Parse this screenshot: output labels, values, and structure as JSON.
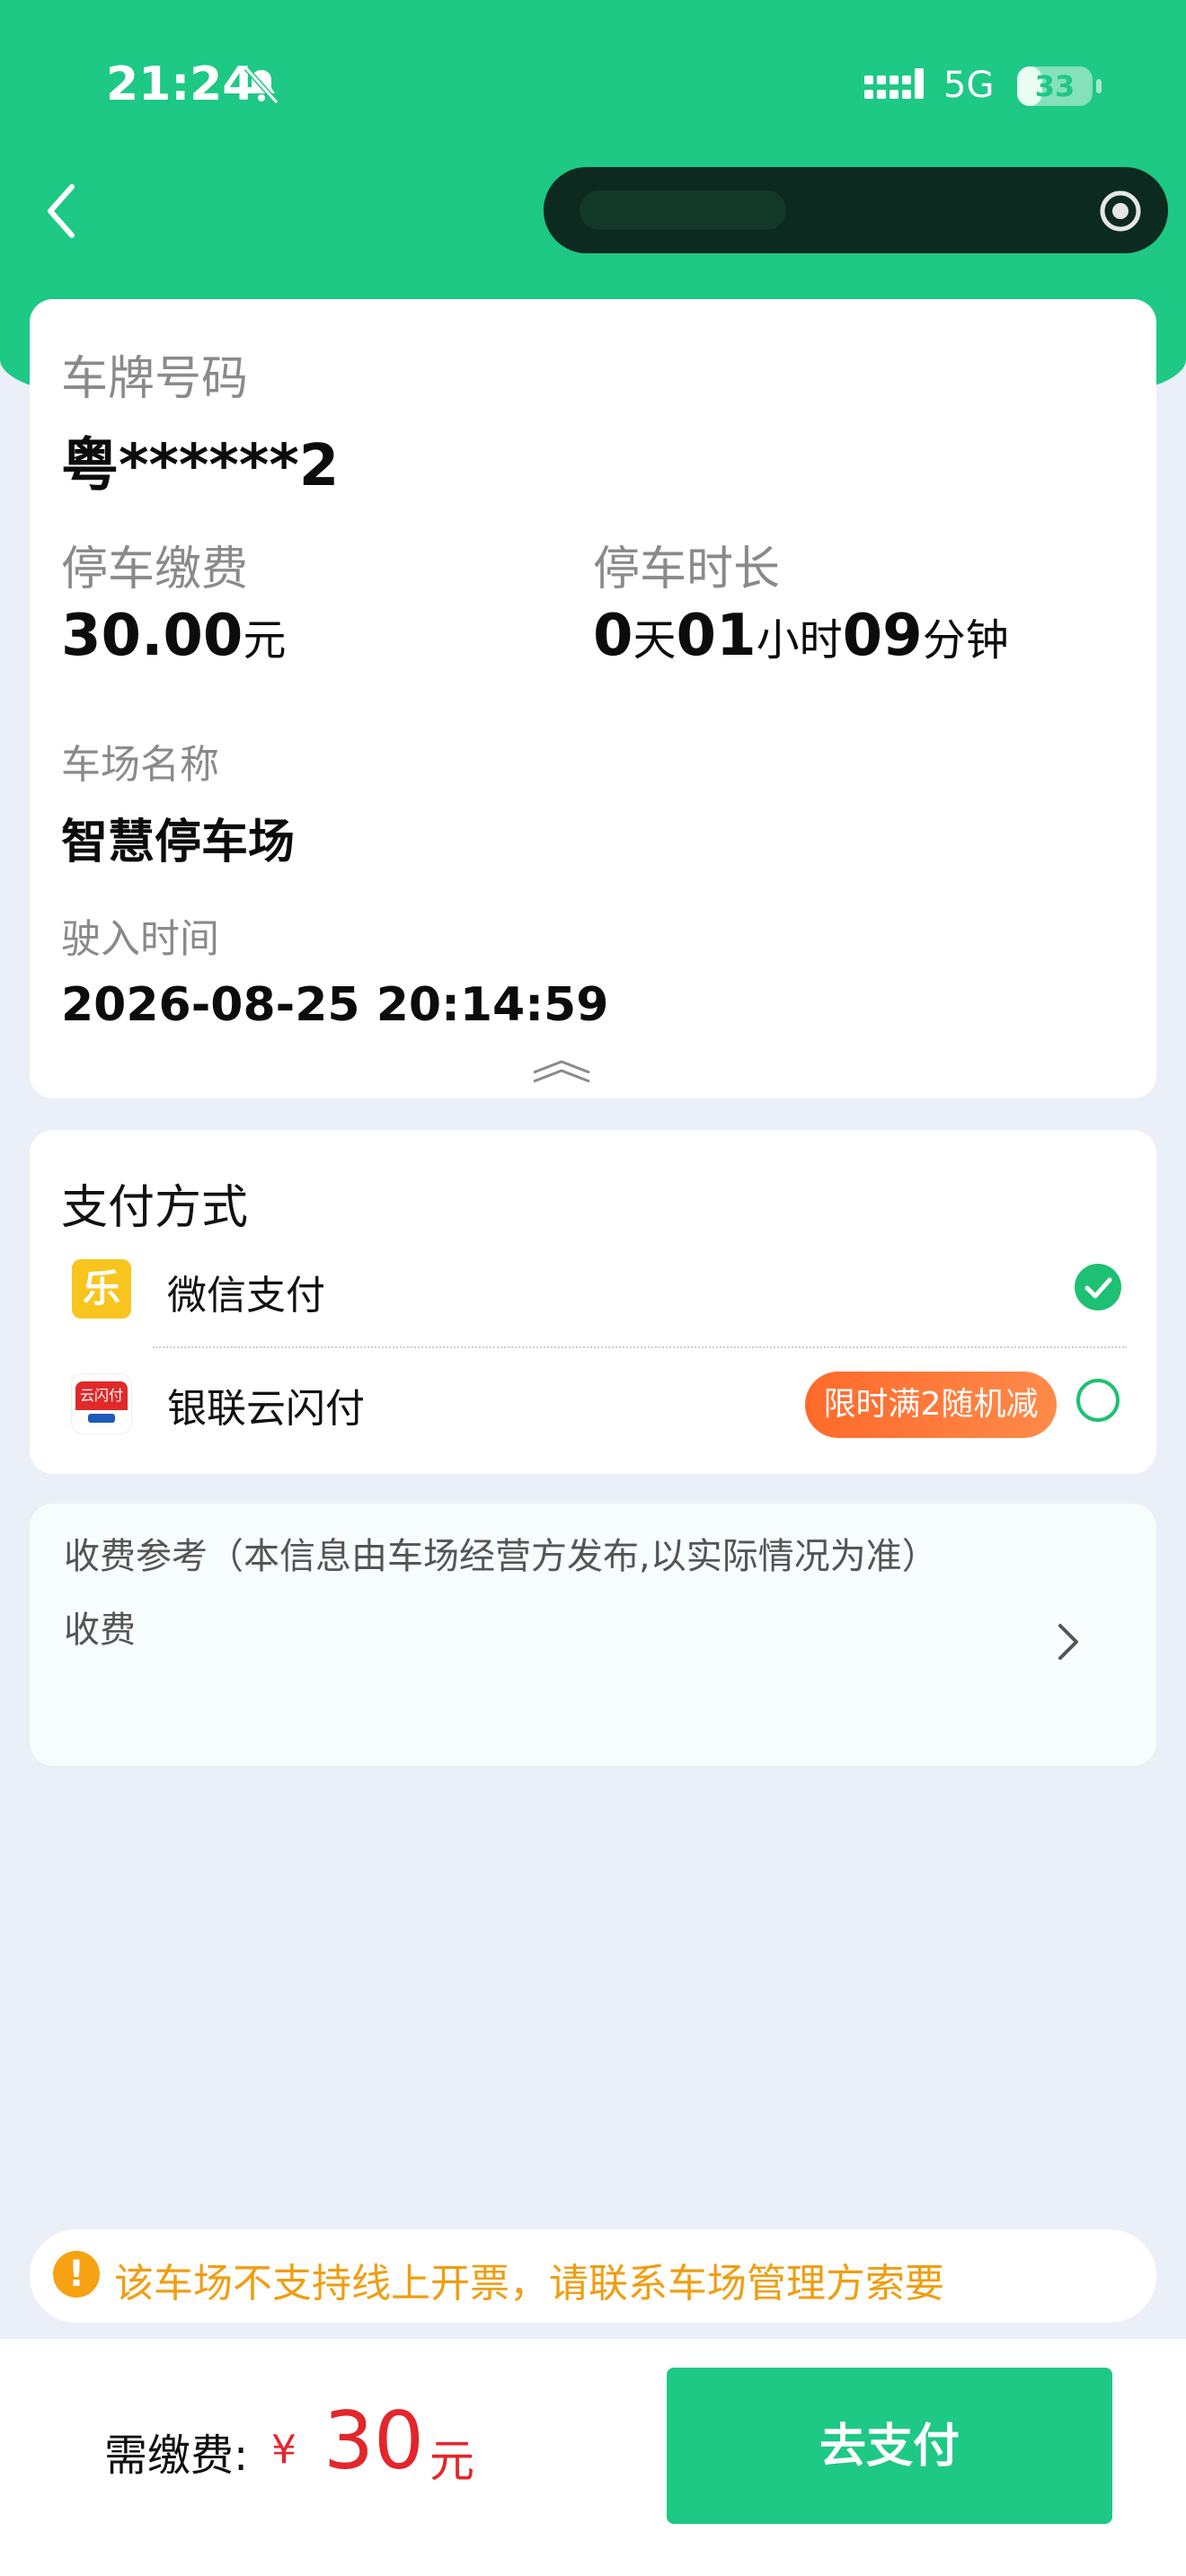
{
  "status_bar": {
    "time": "21:24",
    "network": "5G",
    "battery_level": "33",
    "battery_fraction": 0.33
  },
  "vehicle": {
    "plate_label": "车牌号码",
    "plate_value": "粤******2",
    "fee_label": "停车缴费",
    "fee_amount": "30.00",
    "fee_unit": "元",
    "duration_label": "停车时长",
    "duration": {
      "days": "0",
      "days_unit": "天",
      "hours": "01",
      "hours_unit": "小时",
      "minutes": "09",
      "minutes_unit": "分钟"
    },
    "lot_label": "车场名称",
    "lot_value": "智慧停车场",
    "entry_label": "驶入时间",
    "entry_value": "2026-08-25 20:14:59"
  },
  "payment": {
    "title": "支付方式",
    "methods": [
      {
        "label": "微信支付",
        "logo_text": "乐",
        "selected": true
      },
      {
        "label": "银联云闪付",
        "logo_text": "云闪付",
        "promo": "限时满2随机减",
        "selected": false
      }
    ]
  },
  "fee_reference": {
    "title": "收费参考（本信息由车场经营方发布,以实际情况为准）",
    "subtitle": "收费"
  },
  "notice": {
    "icon_text": "!",
    "text": "该车场不支持线上开票，请联系车场管理方索要"
  },
  "footer": {
    "due_label": "需缴费:",
    "currency": "¥",
    "amount": "30",
    "unit": "元",
    "pay_button": "去支付"
  },
  "colors": {
    "brand_green": "#1ec885",
    "price_red": "#e3262b",
    "warning_orange": "#ef9e12",
    "promo_orange": "#ff6a2a"
  }
}
